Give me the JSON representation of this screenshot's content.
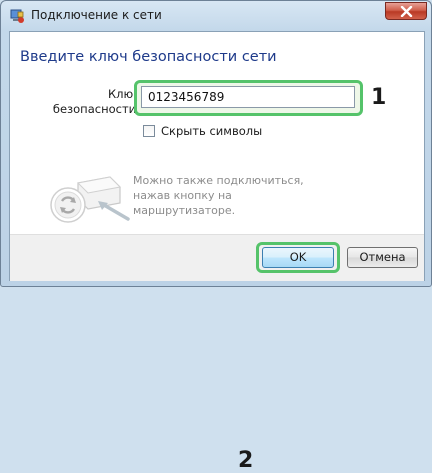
{
  "window": {
    "title": "Подключение к сети",
    "close_icon": "close-icon"
  },
  "dialog": {
    "heading": "Введите ключ безопасности сети",
    "key_label_line1": "Ключ",
    "key_label_line2": "безопасности:",
    "key_value": "0123456789",
    "hide_symbols_label": "Скрыть символы",
    "hide_symbols_checked": false,
    "router_hint": "Можно также подключиться, нажав кнопку на маршрутизаторе."
  },
  "annotations": {
    "badge1": "1",
    "badge2": "2",
    "highlight_color": "#55c36a"
  },
  "buttons": {
    "ok_label": "OK",
    "cancel_label": "Отмена"
  },
  "colors": {
    "heading": "#1e3a8a",
    "hint_text": "#8c8c8c"
  }
}
